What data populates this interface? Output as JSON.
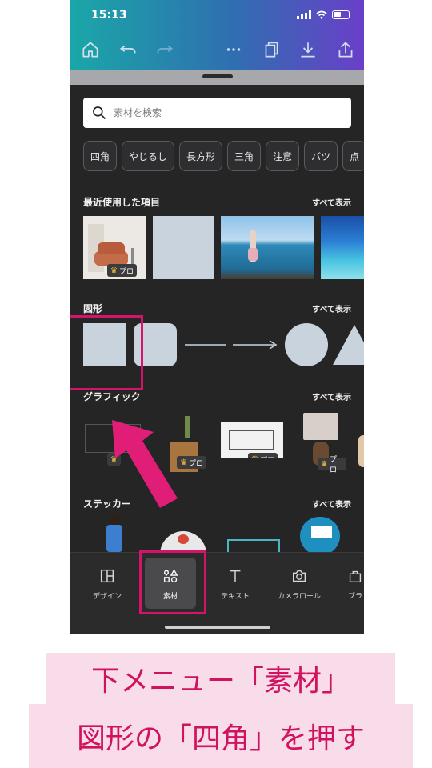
{
  "status_bar": {
    "time": "15:13"
  },
  "toolbar": {
    "icons": [
      "home-icon",
      "undo-icon",
      "redo-icon",
      "more-icon",
      "pages-icon",
      "download-icon",
      "share-icon"
    ]
  },
  "search": {
    "placeholder": "素材を検索",
    "value": ""
  },
  "chips": [
    "四角",
    "やじるし",
    "長方形",
    "三角",
    "注意",
    "バツ",
    "点"
  ],
  "sections": {
    "recent": {
      "title": "最近使用した項目",
      "link": "すべて表示",
      "pro_label": "プロ"
    },
    "shapes": {
      "title": "図形",
      "link": "すべて表示"
    },
    "graphics": {
      "title": "グラフィック",
      "link": "すべて表示",
      "pro_label": "プロ"
    },
    "stickers": {
      "title": "ステッカー",
      "link": "すべて表示"
    }
  },
  "bottom_nav": [
    {
      "label": "デザイン",
      "icon": "layout-icon"
    },
    {
      "label": "素材",
      "icon": "elements-icon",
      "active": true
    },
    {
      "label": "テキスト",
      "icon": "text-icon"
    },
    {
      "label": "カメラロール",
      "icon": "camera-icon"
    },
    {
      "label": "ブラ",
      "icon": "brand-icon"
    }
  ],
  "caption": {
    "line1": "下メニュー「素材」",
    "line2": "図形の「四角」を押す"
  },
  "colors": {
    "highlight": "#d6136b",
    "caption_bg": "#f9dcea",
    "caption_text": "#d0135f"
  }
}
